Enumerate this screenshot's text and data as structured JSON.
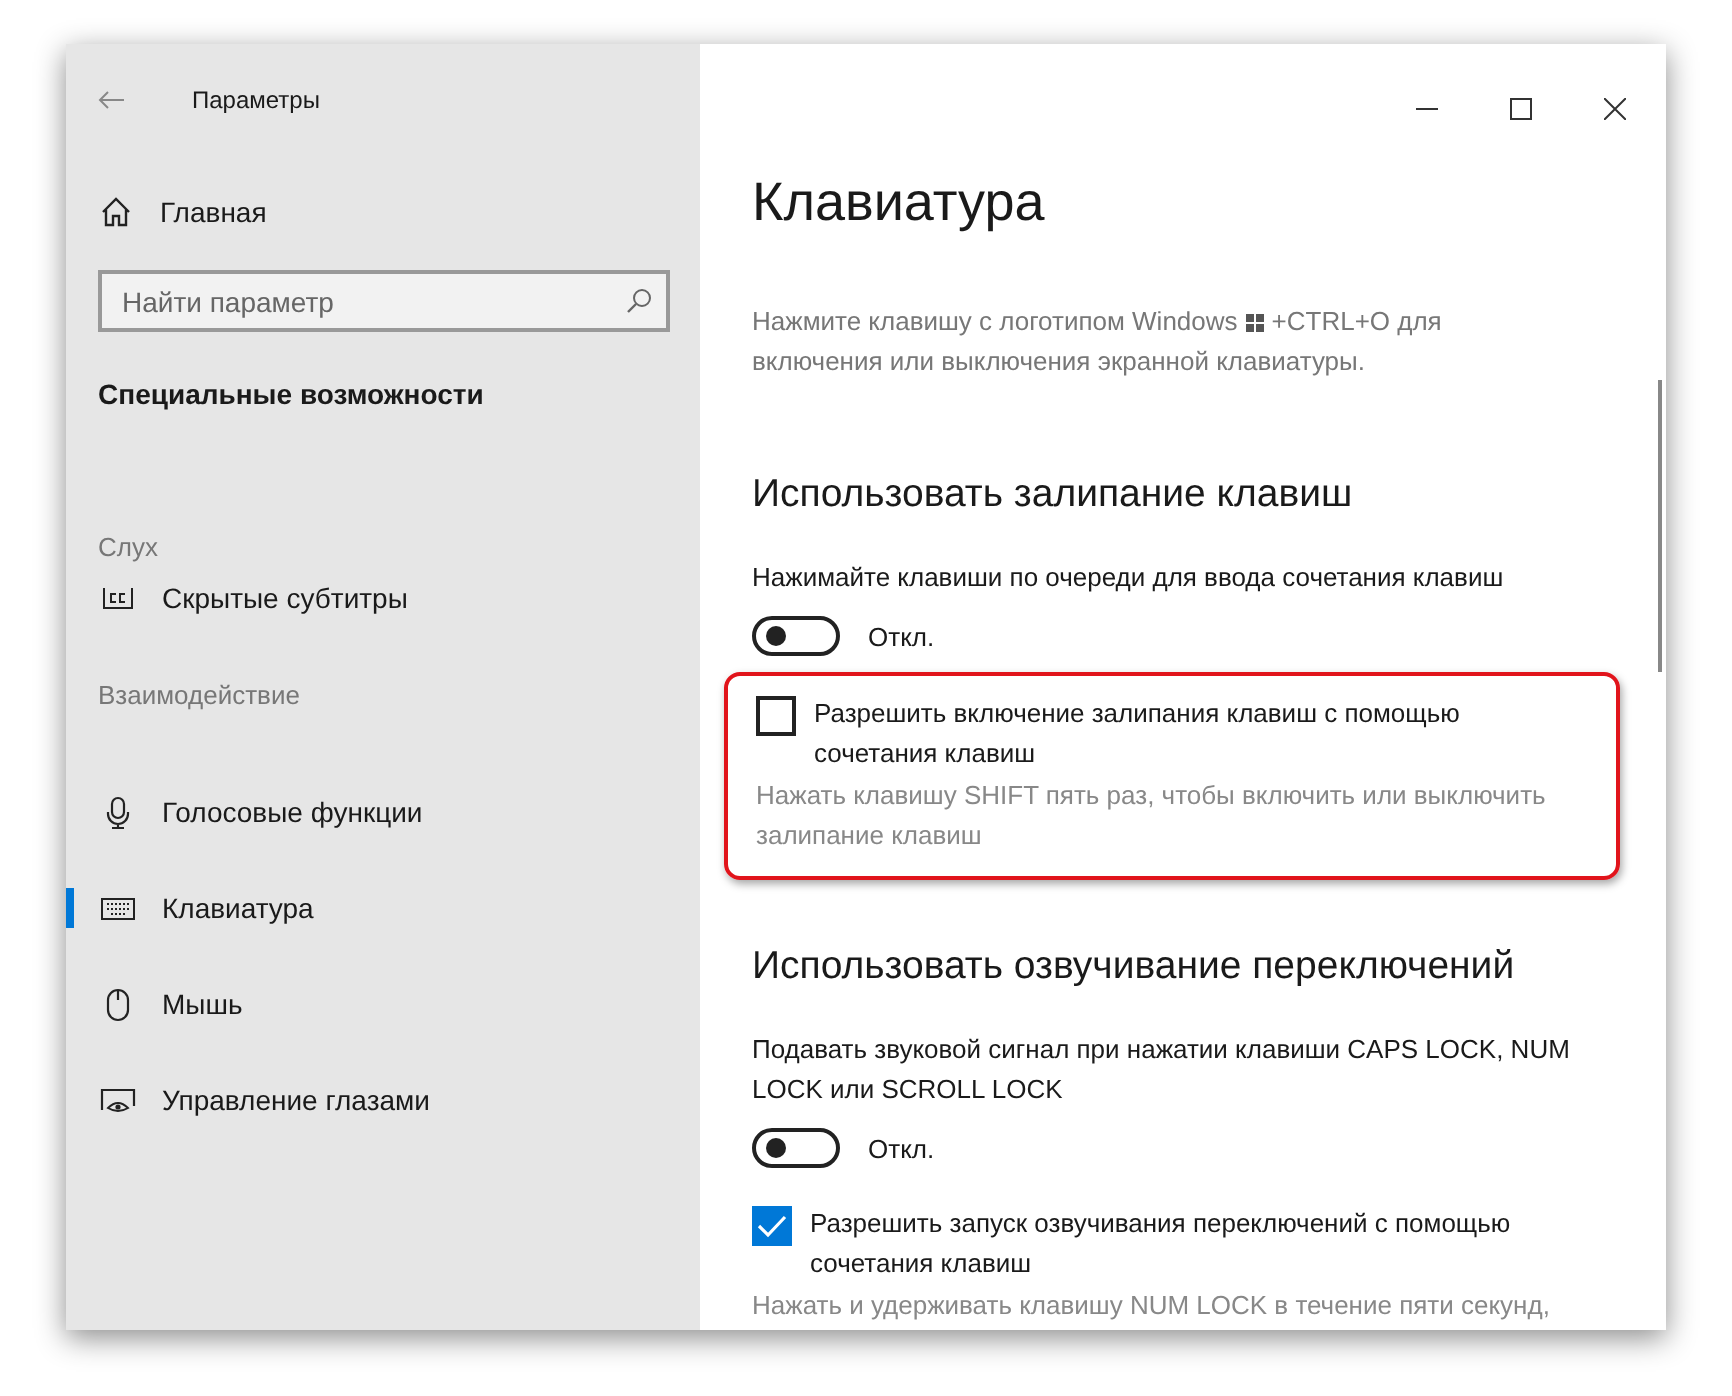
{
  "window": {
    "title": "Параметры"
  },
  "sidebar": {
    "home": "Главная",
    "search": {
      "placeholder": "Найти параметр"
    },
    "category": "Специальные возможности",
    "groups": [
      {
        "title": "Слух",
        "items": [
          {
            "label": "Скрытые субтитры",
            "selected": false
          }
        ]
      },
      {
        "title": "Взаимодействие",
        "items": [
          {
            "label": "Голосовые функции",
            "selected": false
          },
          {
            "label": "Клавиатура",
            "selected": true
          },
          {
            "label": "Мышь",
            "selected": false
          },
          {
            "label": "Управление глазами",
            "selected": false
          }
        ]
      }
    ]
  },
  "page": {
    "title": "Клавиатура",
    "intro": {
      "before": "Нажмите клавишу с логотипом Windows",
      "after": "+CTRL+O для",
      "line2": "включения или выключения экранной клавиатуры."
    },
    "sections": [
      {
        "heading": "Использовать залипание клавиш",
        "items": [
          {
            "kind": "text",
            "text": "Нажимайте клавиши по очереди для ввода сочетания клавиш"
          },
          {
            "kind": "toggle",
            "on": false,
            "label": "Откл."
          },
          {
            "kind": "checkbox",
            "checked": false,
            "highlighted": true,
            "label": "Разрешить включение залипания клавиш с помощью сочетания клавиш",
            "hint": "Нажать клавишу SHIFT пять раз, чтобы включить или выключить залипание клавиш"
          }
        ]
      },
      {
        "heading": "Использовать озвучивание переключений",
        "items": [
          {
            "kind": "text",
            "text": "Подавать звуковой сигнал при нажатии клавиши CAPS LOCK, NUM LOCK или SCROLL LOCK"
          },
          {
            "kind": "toggle",
            "on": false,
            "label": "Откл."
          },
          {
            "kind": "checkbox",
            "checked": true,
            "highlighted": false,
            "label": "Разрешить запуск озвучивания переключений с помощью сочетания клавиш",
            "hint": "Нажать и удерживать клавишу NUM LOCK в течение пяти секунд,"
          }
        ]
      }
    ]
  }
}
